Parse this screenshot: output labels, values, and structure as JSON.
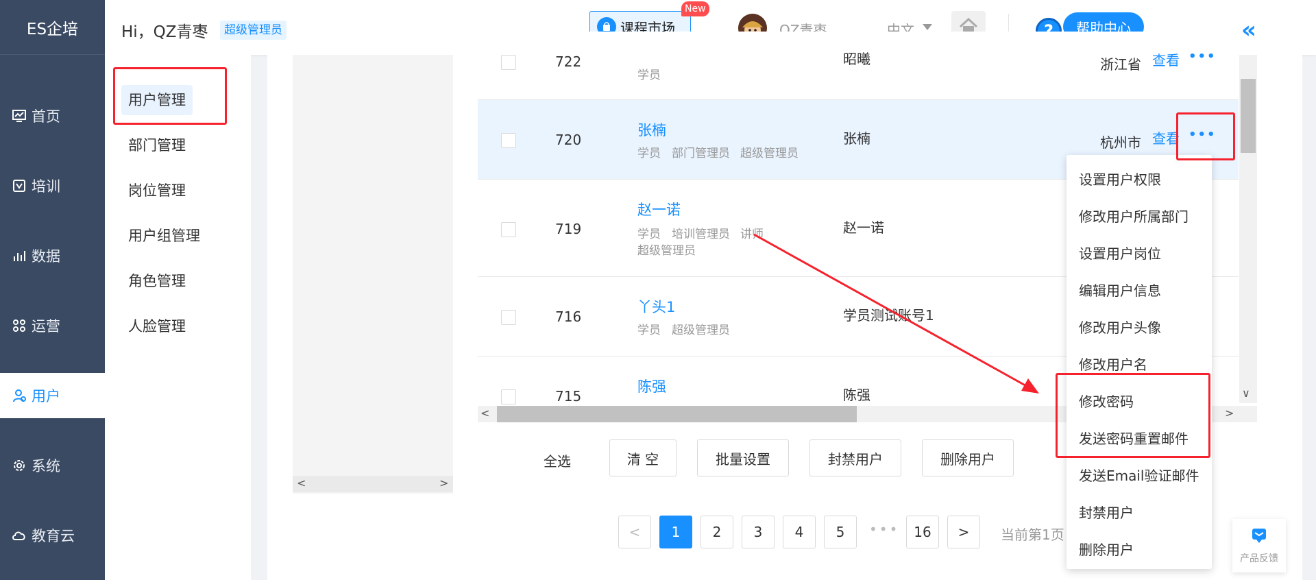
{
  "app": {
    "brand": "ES企培"
  },
  "sidebar": {
    "items": [
      {
        "label": "首页",
        "icon": "dashboard-icon"
      },
      {
        "label": "培训",
        "icon": "training-icon"
      },
      {
        "label": "数据",
        "icon": "chart-icon"
      },
      {
        "label": "运营",
        "icon": "operation-icon"
      },
      {
        "label": "用户",
        "icon": "user-icon",
        "active": true
      },
      {
        "label": "系统",
        "icon": "gear-icon"
      },
      {
        "label": "教育云",
        "icon": "cloud-icon"
      }
    ]
  },
  "header": {
    "greeting": "Hi，QZ青枣",
    "role_badge": "超级管理员",
    "market_label": "课程市场",
    "new_badge": "New",
    "username": "QZ青枣",
    "language": "中文",
    "help_label": "帮助中心",
    "help_icon_text": "?",
    "collapse_icon_text": "«"
  },
  "subnav": {
    "items": [
      {
        "label": "用户管理",
        "active": true
      },
      {
        "label": "部门管理"
      },
      {
        "label": "岗位管理"
      },
      {
        "label": "用户组管理"
      },
      {
        "label": "角色管理"
      },
      {
        "label": "人脸管理"
      }
    ]
  },
  "table": {
    "rows": [
      {
        "id": "722",
        "name": "",
        "roles": [
          "学员"
        ],
        "realname": "昭曦",
        "city": "浙江省",
        "view": "查看",
        "more": "•••"
      },
      {
        "id": "720",
        "name": "张楠",
        "roles": [
          "学员",
          "部门管理员",
          "超级管理员"
        ],
        "realname": "张楠",
        "city": "杭州市",
        "view": "查看",
        "more": "•••"
      },
      {
        "id": "719",
        "name": "赵一诺",
        "roles": [
          "学员",
          "培训管理员",
          "讲师"
        ],
        "roles2": "超级管理员",
        "realname": "赵一诺",
        "city": "",
        "view": "",
        "more": ""
      },
      {
        "id": "716",
        "name": "丫头1",
        "roles": [
          "学员",
          "超级管理员"
        ],
        "realname": "学员测试账号1",
        "city": "",
        "view": "",
        "more": ""
      },
      {
        "id": "715",
        "name": "陈强",
        "roles": [],
        "realname": "陈强",
        "city": "",
        "view": "",
        "more": ""
      }
    ],
    "scroll_left": "<",
    "scroll_right": ">",
    "scroll_down": "∨"
  },
  "bulk": {
    "select_all": "全选",
    "clear": "清 空",
    "batch_set": "批量设置",
    "ban_users": "封禁用户",
    "delete_users": "删除用户"
  },
  "pagination": {
    "prev": "<",
    "pages": [
      "1",
      "2",
      "3",
      "4",
      "5"
    ],
    "ellipsis": "•••",
    "last": "16",
    "next": ">",
    "info": "当前第1页"
  },
  "dropdown": {
    "items": [
      "设置用户权限",
      "修改用户所属部门",
      "设置用户岗位",
      "编辑用户信息",
      "修改用户头像",
      "修改用户名",
      "修改密码",
      "发送密码重置邮件",
      "发送Email验证邮件",
      "封禁用户",
      "删除用户"
    ]
  },
  "feedback": {
    "label": "产品反馈"
  },
  "colors": {
    "sidebar_bg": "#3a4a63",
    "accent": "#1890ff",
    "highlight_red": "#f5222d"
  }
}
